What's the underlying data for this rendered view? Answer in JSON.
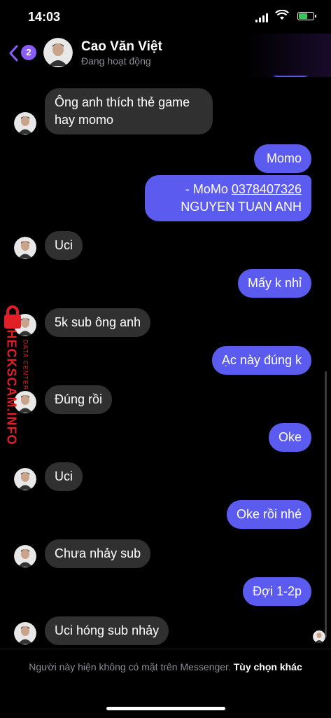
{
  "status_bar": {
    "time": "14:03"
  },
  "header": {
    "back_badge": "2",
    "contact_name": "Cao Văn Việt",
    "presence": "Đang hoạt động"
  },
  "messages": [
    {
      "dir": "in",
      "lines": [
        "Ông anh thích thẻ game",
        "hay momo"
      ]
    },
    {
      "dir": "out",
      "lines": [
        "Momo"
      ]
    },
    {
      "dir": "out",
      "lines_prefix": "- MoMo ",
      "link": "0378407326",
      "line2": "NGUYEN TUAN ANH"
    },
    {
      "dir": "in",
      "lines": [
        "Uci"
      ]
    },
    {
      "dir": "out",
      "lines": [
        "Mấy k nhỉ"
      ]
    },
    {
      "dir": "in",
      "lines": [
        "5k sub ông anh"
      ]
    },
    {
      "dir": "out",
      "lines": [
        "Ạc này đúng k"
      ]
    },
    {
      "dir": "in",
      "lines": [
        "Đúng rồi"
      ]
    },
    {
      "dir": "out",
      "lines": [
        "Oke"
      ]
    },
    {
      "dir": "in",
      "lines": [
        "Uci"
      ]
    },
    {
      "dir": "out",
      "lines": [
        "Oke rồi nhé"
      ]
    },
    {
      "dir": "in",
      "lines": [
        "Chưa nhảy sub"
      ]
    },
    {
      "dir": "out",
      "lines": [
        "Đợi 1-2p"
      ]
    },
    {
      "dir": "in",
      "lines": [
        "Uci hóng sub nhảy"
      ]
    }
  ],
  "watermark": {
    "main": "CHECKSCAM.INFO",
    "sub": "DATA CENTER"
  },
  "footer": {
    "notice": "Người này hiện không có mặt trên Messenger.",
    "link": "Tùy chọn khác"
  },
  "colors": {
    "outgoing": "#5b5bf0",
    "incoming": "#303030",
    "accent": "#8b5cf6"
  }
}
